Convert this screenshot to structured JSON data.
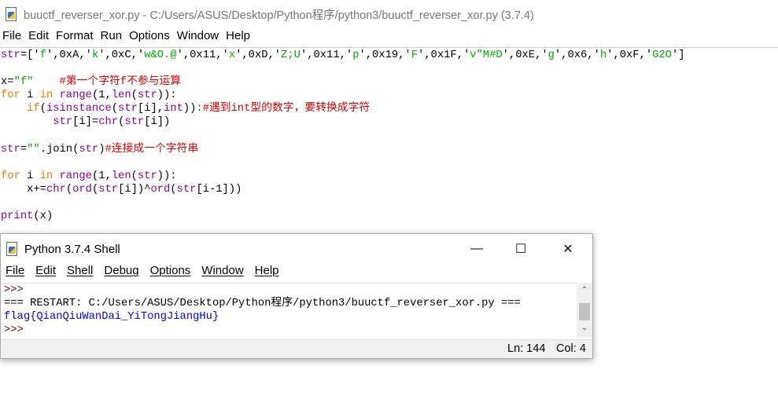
{
  "editor": {
    "title": "buuctf_reverser_xor.py - C:/Users/ASUS/Desktop/Python程序/python3/buuctf_reverser_xor.py (3.7.4)",
    "menu": [
      "File",
      "Edit",
      "Format",
      "Run",
      "Options",
      "Window",
      "Help"
    ],
    "code": [
      [
        [
          "str",
          "b"
        ],
        [
          "=['",
          ""
        ],
        [
          "f",
          "s"
        ],
        [
          "',0xA,'",
          ""
        ],
        [
          "k",
          "s"
        ],
        [
          "',0xC,'",
          ""
        ],
        [
          "w&O.@",
          "s"
        ],
        [
          "',0x11,'",
          ""
        ],
        [
          "x",
          "s"
        ],
        [
          "',0xD,'",
          ""
        ],
        [
          "Z;U",
          "s"
        ],
        [
          "',0x11,'",
          ""
        ],
        [
          "p",
          "s"
        ],
        [
          "',0x19,'",
          ""
        ],
        [
          "F",
          "s"
        ],
        [
          "',0x1F,'",
          ""
        ],
        [
          "v\"M#D",
          "s"
        ],
        [
          "',0xE,'",
          ""
        ],
        [
          "g",
          "s"
        ],
        [
          "',0x6,'",
          ""
        ],
        [
          "h",
          "s"
        ],
        [
          "',0xF,'",
          ""
        ],
        [
          "G2O",
          "s"
        ],
        [
          "']",
          ""
        ]
      ],
      [],
      [
        [
          "x=",
          ""
        ],
        [
          "\"f\"",
          "s"
        ],
        [
          "    #第一个字符f不参与运算",
          "c"
        ]
      ],
      [
        [
          "for",
          "k"
        ],
        [
          " i ",
          ""
        ],
        [
          "in",
          "k"
        ],
        [
          " ",
          ""
        ],
        [
          "range",
          "b"
        ],
        [
          "(1,",
          ""
        ],
        [
          "len",
          "b"
        ],
        [
          "(",
          ""
        ],
        [
          "str",
          "b"
        ],
        [
          ")):",
          ""
        ]
      ],
      [
        [
          "    ",
          ""
        ],
        [
          "if",
          "k"
        ],
        [
          "(",
          ""
        ],
        [
          "isinstance",
          "b"
        ],
        [
          "(",
          ""
        ],
        [
          "str",
          "b"
        ],
        [
          "[i],",
          ""
        ],
        [
          "int",
          "b"
        ],
        [
          "))",
          ""
        ],
        [
          ":#遇到int型的数字，要转换成字符",
          "c"
        ]
      ],
      [
        [
          "        ",
          ""
        ],
        [
          "str",
          "b"
        ],
        [
          "[i]=",
          ""
        ],
        [
          "chr",
          "b"
        ],
        [
          "(",
          ""
        ],
        [
          "str",
          "b"
        ],
        [
          "[i])",
          ""
        ]
      ],
      [],
      [
        [
          "str",
          "b"
        ],
        [
          "=",
          ""
        ],
        [
          "\"\"",
          "s"
        ],
        [
          ".join(",
          ""
        ],
        [
          "str",
          "b"
        ],
        [
          ")",
          ""
        ],
        [
          "#连接成一个字符串",
          "c"
        ]
      ],
      [],
      [
        [
          "for",
          "k"
        ],
        [
          " i ",
          ""
        ],
        [
          "in",
          "k"
        ],
        [
          " ",
          ""
        ],
        [
          "range",
          "b"
        ],
        [
          "(1,",
          ""
        ],
        [
          "len",
          "b"
        ],
        [
          "(",
          ""
        ],
        [
          "str",
          "b"
        ],
        [
          ")):",
          ""
        ]
      ],
      [
        [
          "    x+=",
          ""
        ],
        [
          "chr",
          "b"
        ],
        [
          "(",
          ""
        ],
        [
          "ord",
          "b"
        ],
        [
          "(",
          ""
        ],
        [
          "str",
          "b"
        ],
        [
          "[i])^",
          ""
        ],
        [
          "ord",
          "b"
        ],
        [
          "(",
          ""
        ],
        [
          "str",
          "b"
        ],
        [
          "[i-1]))",
          ""
        ]
      ],
      [],
      [
        [
          "print",
          "b"
        ],
        [
          "(x)",
          ""
        ]
      ]
    ]
  },
  "shell": {
    "title": "Python 3.7.4 Shell",
    "menu": [
      "File",
      "Edit",
      "Shell",
      "Debug",
      "Options",
      "Window",
      "Help"
    ],
    "lines": [
      {
        "text": ">>>",
        "cls": "prompt"
      },
      {
        "text": "=== RESTART: C:/Users/ASUS/Desktop/Python程序/python3/buuctf_reverser_xor.py ===",
        "cls": ""
      },
      {
        "text": "flag{QianQiuWanDai_YiTongJiangHu}",
        "cls": "out"
      },
      {
        "text": ">>>",
        "cls": "prompt"
      }
    ],
    "status": {
      "ln": "Ln: 144",
      "col": "Col: 4"
    }
  }
}
